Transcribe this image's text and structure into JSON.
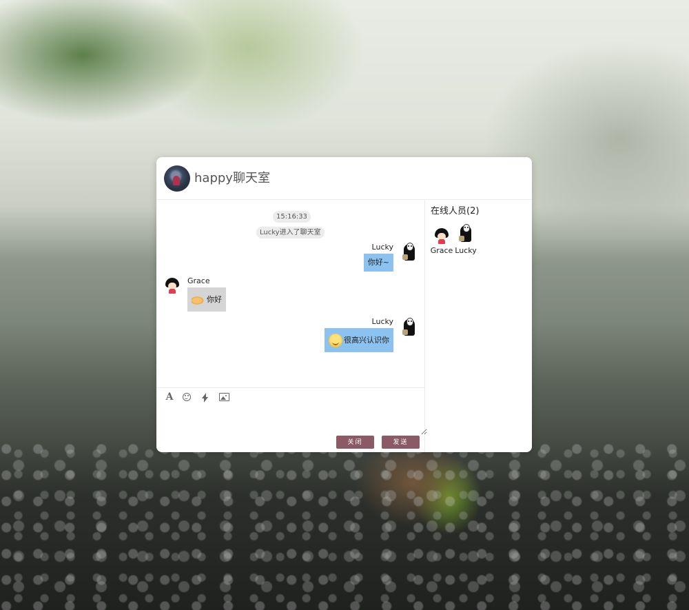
{
  "room": {
    "title": "happy聊天室"
  },
  "messages": {
    "timestamp": "15:16:33",
    "system_notice": "Lucky进入了聊天室",
    "items": [
      {
        "sender": "Lucky",
        "text": "你好~",
        "emoji": "",
        "mine": true
      },
      {
        "sender": "Grace",
        "text": "你好",
        "emoji": "handshake-emoji",
        "mine": false
      },
      {
        "sender": "Lucky",
        "text": "很高兴认识你",
        "emoji": "smile-emoji",
        "mine": true
      }
    ]
  },
  "toolbar": {
    "icons": [
      "font-icon",
      "emoji-icon",
      "lightning-icon",
      "image-icon"
    ]
  },
  "input": {
    "value": "",
    "placeholder": ""
  },
  "buttons": {
    "close_label": "关闭",
    "send_label": "发送"
  },
  "online": {
    "title": "在线人员(2)",
    "members": [
      {
        "name": "Grace",
        "avatar": "girl-avatar"
      },
      {
        "name": "Lucky",
        "avatar": "no-face-avatar"
      }
    ]
  },
  "colors": {
    "my_bubble": "#8cc2f0",
    "their_bubble": "#d5d5d5",
    "button": "#8a5a66"
  }
}
